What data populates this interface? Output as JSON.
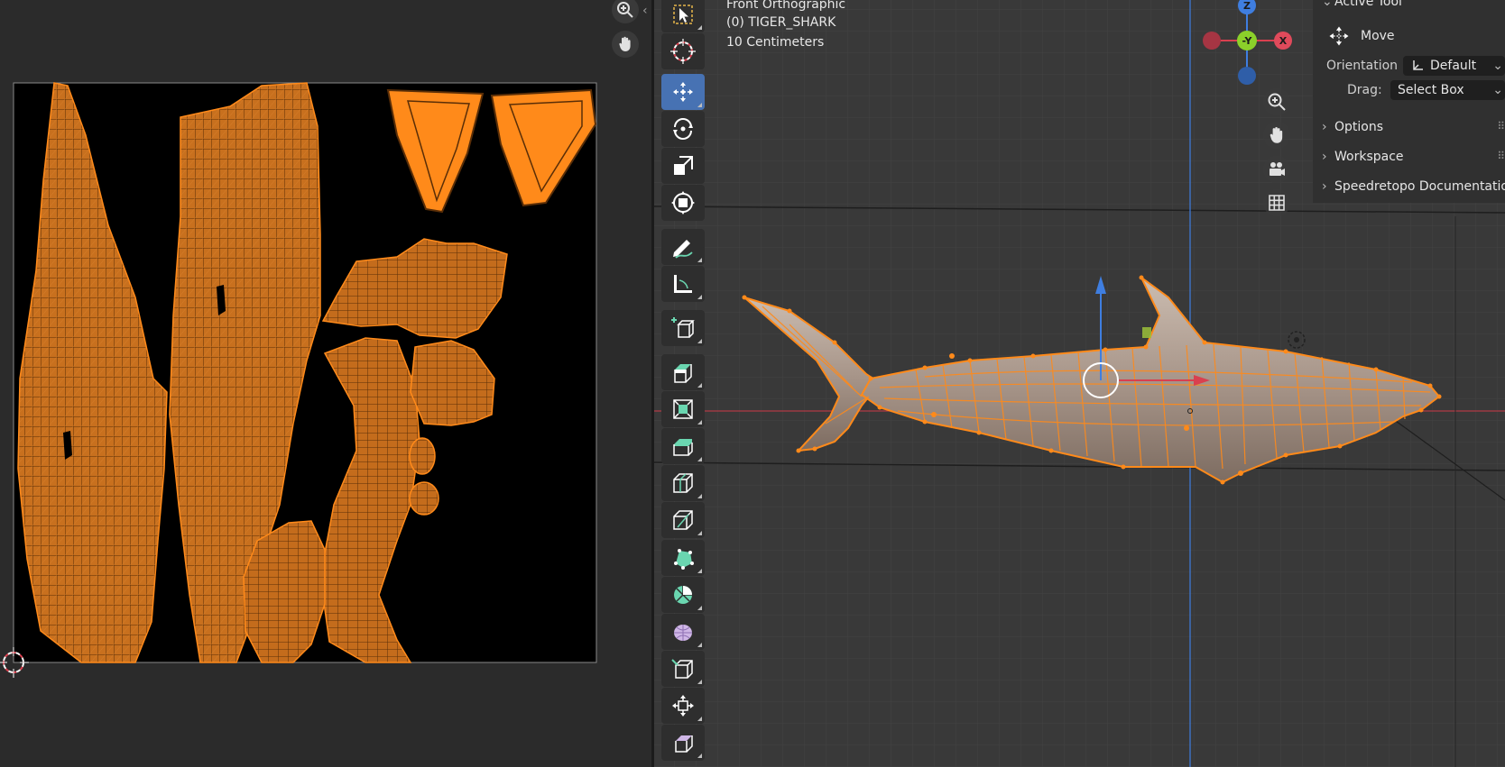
{
  "viewport_info": {
    "view_name": "Front Orthographic",
    "object_label": "(0) TIGER_SHARK",
    "scale_label": "10 Centimeters"
  },
  "gizmo": {
    "z_label": "Z",
    "y_label": "-Y",
    "x_label": "X"
  },
  "n_panel": {
    "active_tool_header": "Active Tool",
    "tool_name": "Move",
    "orientation_label": "Orientation",
    "orientation_value": "Default",
    "drag_label": "Drag:",
    "drag_value": "Select Box",
    "sections": [
      "Options",
      "Workspace",
      "Speedretopo Documentation"
    ]
  },
  "colors": {
    "active_tool": "#4772b3",
    "selection_orange": "#ff8a1a",
    "uv_island": "#c8701e",
    "axis_red": "#d9404f",
    "axis_green": "#8bd12a",
    "axis_blue": "#3f7ee0"
  },
  "toolbar_icons": [
    "select-box-icon",
    "cursor-icon",
    "move-icon",
    "rotate-icon",
    "scale-icon",
    "transform-icon",
    "annotate-icon",
    "measure-icon",
    "add-cube-icon",
    "extrude-region-icon",
    "inset-faces-icon",
    "bevel-icon",
    "loop-cut-icon",
    "knife-icon",
    "poly-build-icon",
    "spin-icon",
    "smooth-icon",
    "edge-slide-icon",
    "shrink-fatten-icon",
    "shear-icon"
  ]
}
